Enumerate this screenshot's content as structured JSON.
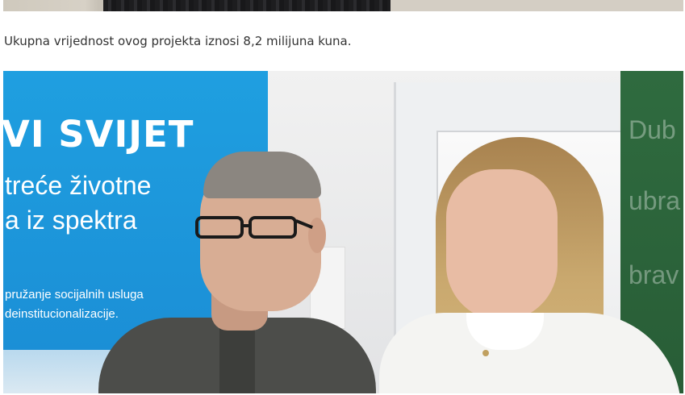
{
  "article": {
    "caption": "Ukupna vrijednost ovog projekta iznosi 8,2 milijuna kuna."
  },
  "photo": {
    "banner_blue": {
      "line1": "VI SVIJET",
      "line2": "treće životne",
      "line3": "a iz spektra",
      "line4": "pružanje socijalnih usluga",
      "line5": "deinstitucionalizacije.",
      "color": "#1f9fe0"
    },
    "banner_green": {
      "line1": "Dub",
      "line2": "ubra",
      "line3": "brav",
      "color": "#2f6b3f"
    }
  }
}
